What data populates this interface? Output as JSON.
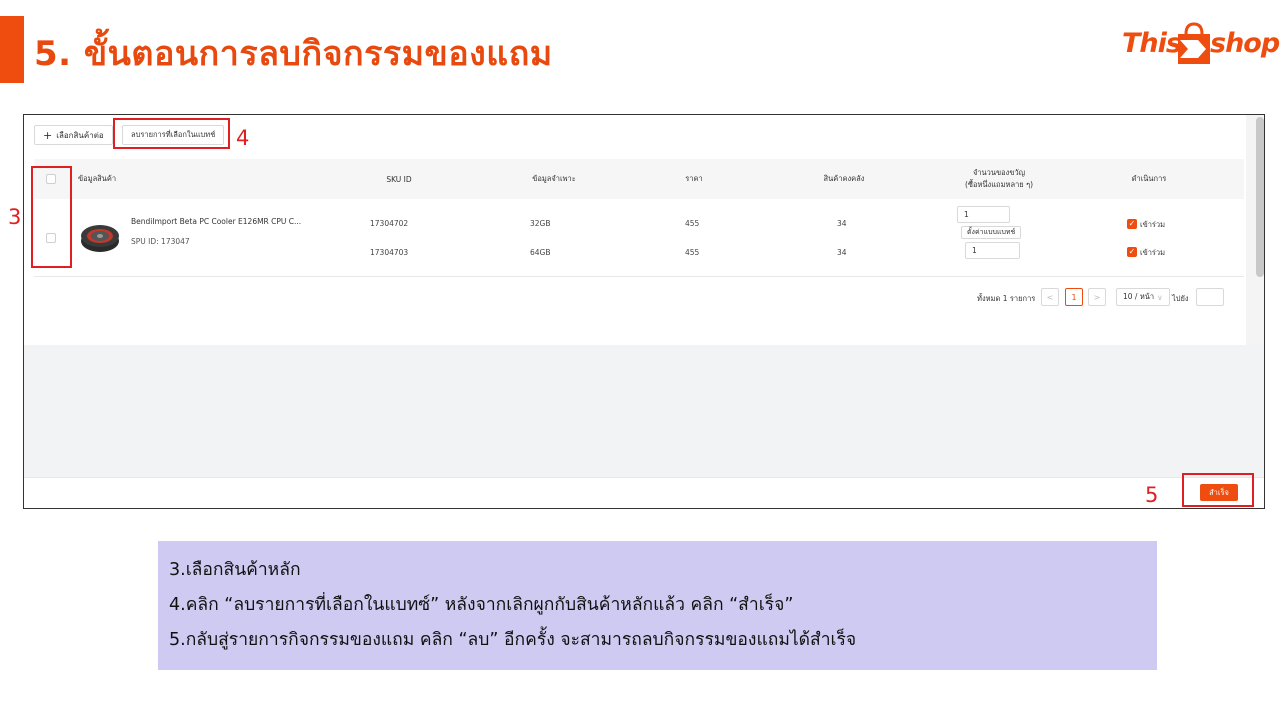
{
  "slide": {
    "title": "5. ขั้นตอนการลบกิจกรรมของแถม",
    "logo": {
      "left_text": "This",
      "right_text": "shop"
    }
  },
  "toolbar": {
    "add_label": "เลือกสินค้าต่อ",
    "remove_selected_label": "ลบรายการที่เลือกในแบทช์"
  },
  "table": {
    "columns": [
      "ข้อมูลสินค้า",
      "SKU ID",
      "ข้อมูลจำเพาะ",
      "ราคา",
      "สินค้าคงคลัง"
    ],
    "gift_qty_header": [
      "จำนวนของขวัญ",
      "(ซื้อหนึ่งแถมหลาย ๆ)"
    ],
    "action_header": "ดำเนินการ",
    "product": {
      "name": "BendiImport Beta PC Cooler E126MR CPU C...",
      "spu": "SPU ID: 173047"
    },
    "skus": [
      {
        "sku_id": "17304702",
        "spec": "32GB",
        "price": "455",
        "stock": "34",
        "gift_qty": "1",
        "action": "เข้าร่วม"
      },
      {
        "sku_id": "17304703",
        "spec": "64GB",
        "price": "455",
        "stock": "34",
        "gift_qty": "1",
        "action": "เข้าร่วม"
      }
    ],
    "batch_set_label": "ตั้งค่าแบบแบทช์"
  },
  "pagination": {
    "total_label": "ทั้งหมด 1 รายการ",
    "current_page": "1",
    "page_size": "10 / หน้า",
    "goto_label": "ไปยัง",
    "prev": "<",
    "next": ">",
    "size_caret": "∨"
  },
  "footer": {
    "done_label": "สำเร็จ"
  },
  "callouts": {
    "step3": "3",
    "step4": "4",
    "step5": "5"
  },
  "instructions": [
    "3.เลือกสินค้าหลัก",
    "4.คลิก “ลบรายการที่เลือกในแบทซ์” หลังจากเลิกผูกกับสินค้าหลักแล้ว คลิก “สำเร็จ”",
    "5.กลับสู่รายการกิจกรรมของแถม คลิก “ลบ” อีกครั้ง จะสามารถลบกิจกรรมของแถมได้สำเร็จ"
  ],
  "colors": {
    "accent": "#ee4d0f",
    "callout": "#e02020",
    "note_bg": "#cfcaf1"
  }
}
